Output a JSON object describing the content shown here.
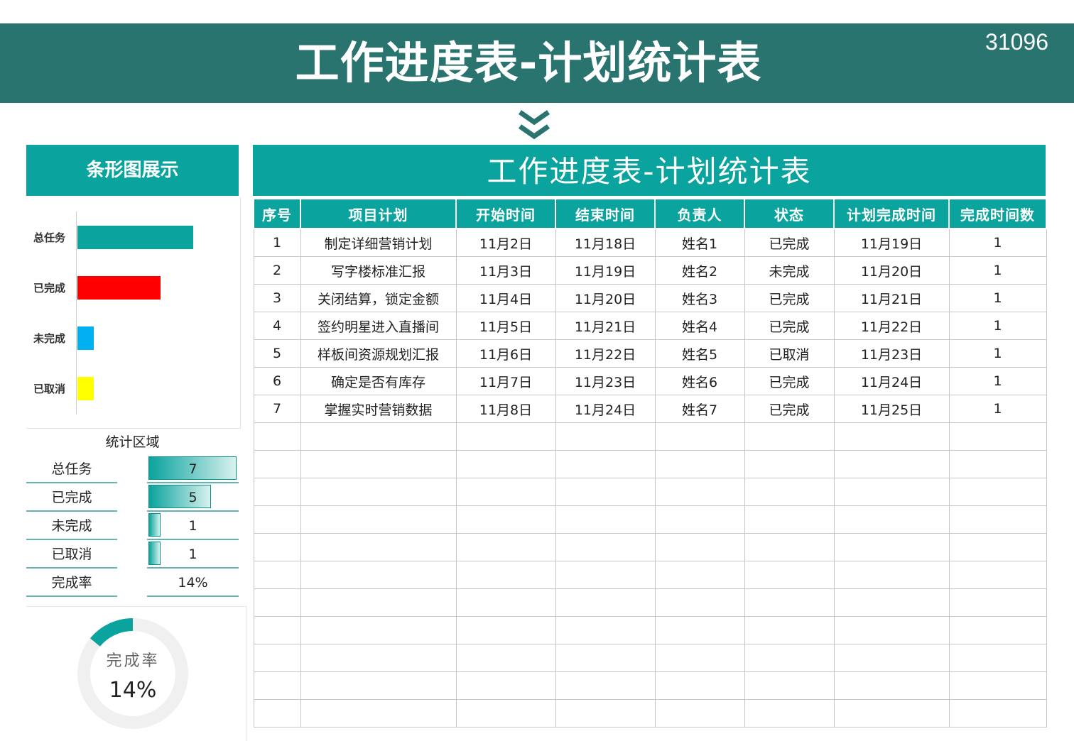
{
  "header": {
    "title": "工作进度表-计划统计表",
    "id": "31096"
  },
  "bar_chart": {
    "heading": "条形图展示",
    "chart_data": {
      "type": "bar",
      "orientation": "horizontal",
      "categories": [
        "总任务",
        "已完成",
        "未完成",
        "已取消"
      ],
      "values": [
        7,
        5,
        1,
        1
      ],
      "colors": [
        "#0aa39d",
        "#ff0000",
        "#00b0f0",
        "#ffff00"
      ],
      "xlim": [
        0,
        9
      ]
    }
  },
  "stats": {
    "title": "统计区域",
    "rows": [
      {
        "label": "总任务",
        "value": "7",
        "fill": 1.0
      },
      {
        "label": "已完成",
        "value": "5",
        "fill": 0.71
      },
      {
        "label": "未完成",
        "value": "1",
        "fill": 0.14
      },
      {
        "label": "已取消",
        "value": "1",
        "fill": 0.14
      },
      {
        "label": "完成率",
        "value": "14%",
        "fill": 0
      }
    ]
  },
  "donut": {
    "label": "完成率",
    "value": "14%",
    "fraction": 0.14,
    "accent": "#0aa39d",
    "track": "#f0f0f0"
  },
  "table": {
    "title": "工作进度表-计划统计表",
    "columns": [
      "序号",
      "项目计划",
      "开始时间",
      "结束时间",
      "负责人",
      "状态",
      "计划完成时间",
      "完成时间数"
    ],
    "rows": [
      [
        "1",
        "制定详细营销计划",
        "11月2日",
        "11月18日",
        "姓名1",
        "已完成",
        "11月19日",
        "1"
      ],
      [
        "2",
        "写字楼标准汇报",
        "11月3日",
        "11月19日",
        "姓名2",
        "未完成",
        "11月20日",
        "1"
      ],
      [
        "3",
        "关闭结算，锁定金额",
        "11月4日",
        "11月20日",
        "姓名3",
        "已完成",
        "11月21日",
        "1"
      ],
      [
        "4",
        "签约明星进入直播间",
        "11月5日",
        "11月21日",
        "姓名4",
        "已完成",
        "11月22日",
        "1"
      ],
      [
        "5",
        "样板间资源规划汇报",
        "11月6日",
        "11月22日",
        "姓名5",
        "已取消",
        "11月23日",
        "1"
      ],
      [
        "6",
        "确定是否有库存",
        "11月7日",
        "11月23日",
        "姓名6",
        "已完成",
        "11月24日",
        "1"
      ],
      [
        "7",
        "掌握实时营销数据",
        "11月8日",
        "11月24日",
        "姓名7",
        "已完成",
        "11月25日",
        "1"
      ]
    ],
    "empty_rows": 11
  },
  "colors": {
    "banner": "#2a7470",
    "accent": "#0aa39d"
  }
}
